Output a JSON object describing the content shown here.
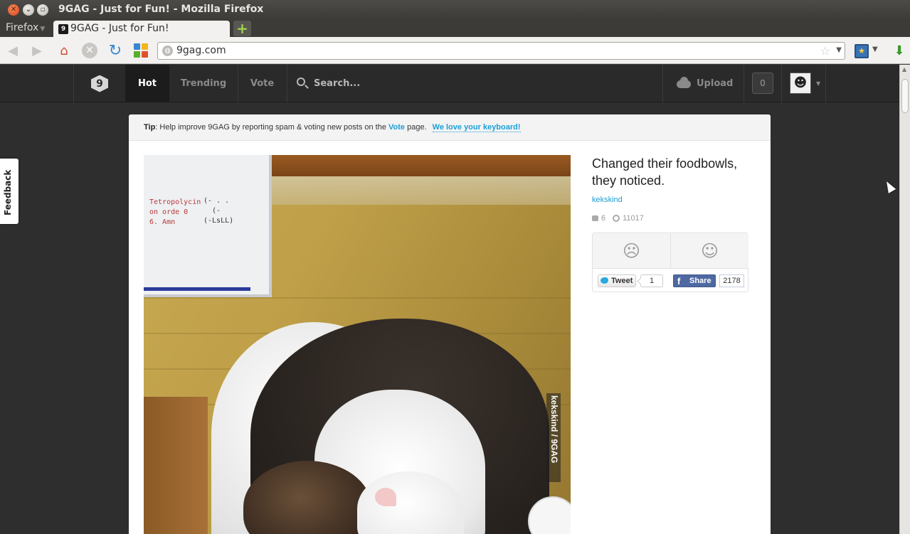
{
  "window": {
    "title": "9GAG - Just for Fun! - Mozilla Firefox"
  },
  "browser": {
    "menu_label": "Firefox",
    "tab_title": "9GAG - Just for Fun!",
    "url": "9gag.com"
  },
  "site_header": {
    "nav": [
      {
        "label": "Hot",
        "active": true
      },
      {
        "label": "Trending",
        "active": false
      },
      {
        "label": "Vote",
        "active": false
      }
    ],
    "search_label": "Search...",
    "upload_label": "Upload",
    "notification_count": "0"
  },
  "feedback_label": "Feedback",
  "tip": {
    "prefix": "Tip",
    "text_before": ": Help improve 9GAG by reporting spam & voting new posts on the ",
    "vote_link": "Vote",
    "text_after": " page.",
    "keyboard_link": "We love your keyboard!"
  },
  "post": {
    "title": "Changed their foodbowls, they noticed.",
    "author": "kekskind",
    "comments": "6",
    "points": "11017",
    "watermark": "kekskind / 9GAG",
    "whiteboard_red": "Tetropolycin\non orde 0\n6. Amn",
    "whiteboard_black": "(- . .\n  (-\n(-LsLL)",
    "social": {
      "tweet_label": "Tweet",
      "tweet_count": "1",
      "share_label": "Share",
      "share_count": "2178"
    }
  },
  "colors": {
    "accent_link": "#1aa0d8",
    "header_bg": "#2a2a2a",
    "facebook_blue": "#4e69a2"
  }
}
